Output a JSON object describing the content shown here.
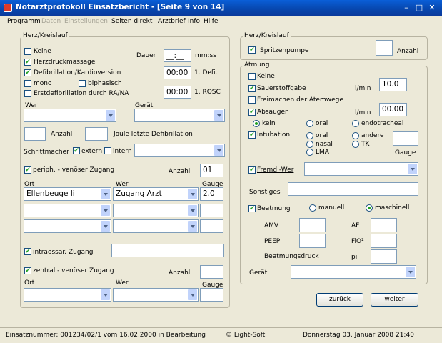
{
  "window": {
    "title": "Notarztprotokoll Einsatzbericht - [Seite 9 von 14]",
    "minimize": "–",
    "maximize": "□",
    "close": "✕"
  },
  "menu": [
    {
      "label": "Programm",
      "disabled": false
    },
    {
      "label": "Daten",
      "disabled": true
    },
    {
      "label": "Einstellungen",
      "disabled": true
    },
    {
      "label": "Seiten direkt",
      "disabled": false
    },
    {
      "label": "Arztbrief",
      "disabled": false
    },
    {
      "label": "Info",
      "disabled": false
    },
    {
      "label": "Hilfe",
      "disabled": false
    }
  ],
  "herz": {
    "title": "Herz/Kreislauf",
    "keine": {
      "label": "Keine",
      "checked": false
    },
    "herzdruckmassage": {
      "label": "Herzdruckmassage",
      "checked": true
    },
    "defibrillation": {
      "label": "Defibrillation/Kardioversion",
      "checked": true
    },
    "mono": {
      "label": "mono",
      "checked": false
    },
    "biphasisch": {
      "label": "biphasisch",
      "checked": false
    },
    "erstdefi": {
      "label": "Erstdefibrillation durch RA/NA",
      "checked": false
    },
    "dauer_label": "Dauer",
    "dauer_value": "__:__",
    "dauer_unit": "mm:ss",
    "defi_time": "00:00",
    "defi_label": "1. Defi.",
    "rosc_time": "00:00",
    "rosc_label": "1. ROSC",
    "wer_label": "Wer",
    "wer_value": "",
    "geraet_label": "Gerät",
    "geraet_value": "",
    "anzahl_label": "Anzahl",
    "anzahl_value": "",
    "joule_value": "",
    "joule_label": "Joule letzte Defibrillation",
    "schrittmacher_label": "Schrittmacher",
    "extern": {
      "label": "extern",
      "checked": true
    },
    "intern": {
      "label": "intern",
      "checked": false
    },
    "schrittmacher_value": "",
    "periph": {
      "label": "periph. - venöser Zugang",
      "checked": true,
      "anzahl_label": "Anzahl",
      "anzahl_value": "01"
    },
    "ort_label": "Ort",
    "wer2_label": "Wer",
    "gauge_label": "Gauge",
    "zugang_rows": [
      {
        "ort": "Ellenbeuge li",
        "wer": "Zugang Arzt",
        "gauge": "2.0"
      },
      {
        "ort": "",
        "wer": "",
        "gauge": ""
      },
      {
        "ort": "",
        "wer": "",
        "gauge": ""
      }
    ],
    "intraossaer": {
      "label": "intraossär. Zugang",
      "checked": true,
      "value": ""
    },
    "zentral": {
      "label": "zentral - venöser Zugang",
      "checked": true,
      "anzahl_label": "Anzahl",
      "anzahl_value": ""
    },
    "zentral_ort_label": "Ort",
    "zentral_wer_label": "Wer",
    "zentral_gauge_label": "Gauge",
    "zentral_row": {
      "ort": "",
      "wer": "",
      "gauge": ""
    }
  },
  "herz2": {
    "title": "Herz/Kreislauf",
    "spritzenpumpe": {
      "label": "Spritzenpumpe",
      "checked": true
    },
    "anzahl_value": "",
    "anzahl_label": "Anzahl"
  },
  "atmung": {
    "title": "Atmung",
    "keine": {
      "label": "Keine",
      "checked": false
    },
    "sauerstoff": {
      "label": "Sauerstoffgabe",
      "checked": true,
      "unit": "l/min",
      "value": "10.0"
    },
    "freimachen": {
      "label": "Freimachen der Atemwege",
      "checked": false
    },
    "absaugen": {
      "label": "Absaugen",
      "checked": true,
      "unit": "l/min",
      "value": "00.00"
    },
    "absaugen_opts": [
      {
        "label": "kein",
        "on": true
      },
      {
        "label": "oral",
        "on": false
      },
      {
        "label": "endotracheal",
        "on": false
      }
    ],
    "intubation": {
      "label": "Intubation",
      "checked": true
    },
    "intub_opts": [
      {
        "label": "oral",
        "on": false
      },
      {
        "label": "andere",
        "on": false
      },
      {
        "label": "nasal",
        "on": false
      },
      {
        "label": "TK",
        "on": false
      },
      {
        "label": "LMA",
        "on": false
      }
    ],
    "gauge_label": "Gauge",
    "gauge_value": "",
    "fremd": {
      "label": "Fremd -Wer",
      "checked": true,
      "value": ""
    },
    "sonstiges_label": "Sonstiges",
    "sonstiges_value": "",
    "beatmung": {
      "label": "Beatmung",
      "checked": true
    },
    "beatmung_opts": [
      {
        "label": "manuell",
        "on": false
      },
      {
        "label": "maschinell",
        "on": true
      }
    ],
    "amv_label": "AMV",
    "af_label": "AF",
    "peep_label": "PEEP",
    "fio2_label": "FiO²",
    "beatmungsdruck_label": "Beatmungsdruck",
    "pi_label": "pi",
    "geraet_label": "Gerät",
    "geraet_value": ""
  },
  "buttons": {
    "zurueck": "zurück",
    "weiter": "weiter"
  },
  "status": {
    "einsatz": "Einsatznummer: 001234/02/1 vom 16.02.2000 in Bearbeitung",
    "copyright": "© Light-Soft",
    "datetime": "Donnerstag  03. Januar 2008   21:40"
  }
}
